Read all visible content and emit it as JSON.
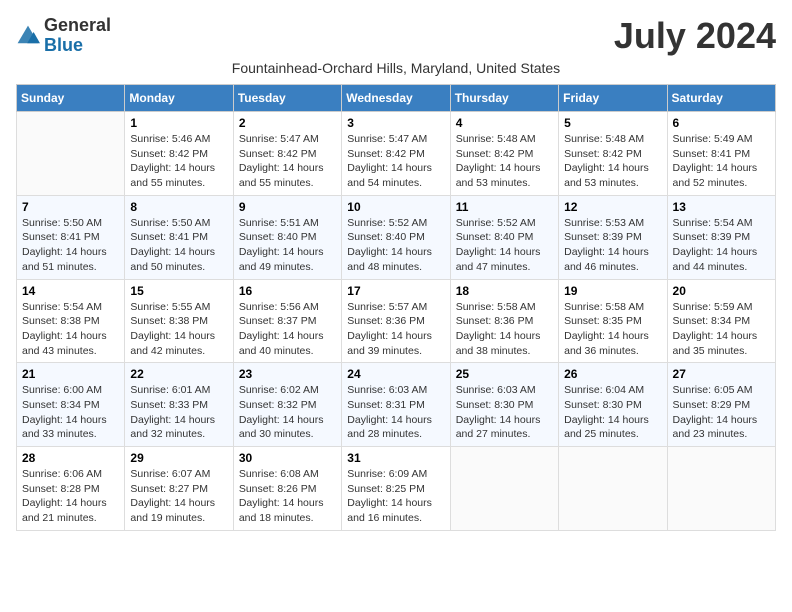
{
  "header": {
    "logo_general": "General",
    "logo_blue": "Blue",
    "month_title": "July 2024",
    "subtitle": "Fountainhead-Orchard Hills, Maryland, United States"
  },
  "days_of_week": [
    "Sunday",
    "Monday",
    "Tuesday",
    "Wednesday",
    "Thursday",
    "Friday",
    "Saturday"
  ],
  "weeks": [
    [
      {
        "day": "",
        "detail": ""
      },
      {
        "day": "1",
        "detail": "Sunrise: 5:46 AM\nSunset: 8:42 PM\nDaylight: 14 hours\nand 55 minutes."
      },
      {
        "day": "2",
        "detail": "Sunrise: 5:47 AM\nSunset: 8:42 PM\nDaylight: 14 hours\nand 55 minutes."
      },
      {
        "day": "3",
        "detail": "Sunrise: 5:47 AM\nSunset: 8:42 PM\nDaylight: 14 hours\nand 54 minutes."
      },
      {
        "day": "4",
        "detail": "Sunrise: 5:48 AM\nSunset: 8:42 PM\nDaylight: 14 hours\nand 53 minutes."
      },
      {
        "day": "5",
        "detail": "Sunrise: 5:48 AM\nSunset: 8:42 PM\nDaylight: 14 hours\nand 53 minutes."
      },
      {
        "day": "6",
        "detail": "Sunrise: 5:49 AM\nSunset: 8:41 PM\nDaylight: 14 hours\nand 52 minutes."
      }
    ],
    [
      {
        "day": "7",
        "detail": "Sunrise: 5:50 AM\nSunset: 8:41 PM\nDaylight: 14 hours\nand 51 minutes."
      },
      {
        "day": "8",
        "detail": "Sunrise: 5:50 AM\nSunset: 8:41 PM\nDaylight: 14 hours\nand 50 minutes."
      },
      {
        "day": "9",
        "detail": "Sunrise: 5:51 AM\nSunset: 8:40 PM\nDaylight: 14 hours\nand 49 minutes."
      },
      {
        "day": "10",
        "detail": "Sunrise: 5:52 AM\nSunset: 8:40 PM\nDaylight: 14 hours\nand 48 minutes."
      },
      {
        "day": "11",
        "detail": "Sunrise: 5:52 AM\nSunset: 8:40 PM\nDaylight: 14 hours\nand 47 minutes."
      },
      {
        "day": "12",
        "detail": "Sunrise: 5:53 AM\nSunset: 8:39 PM\nDaylight: 14 hours\nand 46 minutes."
      },
      {
        "day": "13",
        "detail": "Sunrise: 5:54 AM\nSunset: 8:39 PM\nDaylight: 14 hours\nand 44 minutes."
      }
    ],
    [
      {
        "day": "14",
        "detail": "Sunrise: 5:54 AM\nSunset: 8:38 PM\nDaylight: 14 hours\nand 43 minutes."
      },
      {
        "day": "15",
        "detail": "Sunrise: 5:55 AM\nSunset: 8:38 PM\nDaylight: 14 hours\nand 42 minutes."
      },
      {
        "day": "16",
        "detail": "Sunrise: 5:56 AM\nSunset: 8:37 PM\nDaylight: 14 hours\nand 40 minutes."
      },
      {
        "day": "17",
        "detail": "Sunrise: 5:57 AM\nSunset: 8:36 PM\nDaylight: 14 hours\nand 39 minutes."
      },
      {
        "day": "18",
        "detail": "Sunrise: 5:58 AM\nSunset: 8:36 PM\nDaylight: 14 hours\nand 38 minutes."
      },
      {
        "day": "19",
        "detail": "Sunrise: 5:58 AM\nSunset: 8:35 PM\nDaylight: 14 hours\nand 36 minutes."
      },
      {
        "day": "20",
        "detail": "Sunrise: 5:59 AM\nSunset: 8:34 PM\nDaylight: 14 hours\nand 35 minutes."
      }
    ],
    [
      {
        "day": "21",
        "detail": "Sunrise: 6:00 AM\nSunset: 8:34 PM\nDaylight: 14 hours\nand 33 minutes."
      },
      {
        "day": "22",
        "detail": "Sunrise: 6:01 AM\nSunset: 8:33 PM\nDaylight: 14 hours\nand 32 minutes."
      },
      {
        "day": "23",
        "detail": "Sunrise: 6:02 AM\nSunset: 8:32 PM\nDaylight: 14 hours\nand 30 minutes."
      },
      {
        "day": "24",
        "detail": "Sunrise: 6:03 AM\nSunset: 8:31 PM\nDaylight: 14 hours\nand 28 minutes."
      },
      {
        "day": "25",
        "detail": "Sunrise: 6:03 AM\nSunset: 8:30 PM\nDaylight: 14 hours\nand 27 minutes."
      },
      {
        "day": "26",
        "detail": "Sunrise: 6:04 AM\nSunset: 8:30 PM\nDaylight: 14 hours\nand 25 minutes."
      },
      {
        "day": "27",
        "detail": "Sunrise: 6:05 AM\nSunset: 8:29 PM\nDaylight: 14 hours\nand 23 minutes."
      }
    ],
    [
      {
        "day": "28",
        "detail": "Sunrise: 6:06 AM\nSunset: 8:28 PM\nDaylight: 14 hours\nand 21 minutes."
      },
      {
        "day": "29",
        "detail": "Sunrise: 6:07 AM\nSunset: 8:27 PM\nDaylight: 14 hours\nand 19 minutes."
      },
      {
        "day": "30",
        "detail": "Sunrise: 6:08 AM\nSunset: 8:26 PM\nDaylight: 14 hours\nand 18 minutes."
      },
      {
        "day": "31",
        "detail": "Sunrise: 6:09 AM\nSunset: 8:25 PM\nDaylight: 14 hours\nand 16 minutes."
      },
      {
        "day": "",
        "detail": ""
      },
      {
        "day": "",
        "detail": ""
      },
      {
        "day": "",
        "detail": ""
      }
    ]
  ]
}
